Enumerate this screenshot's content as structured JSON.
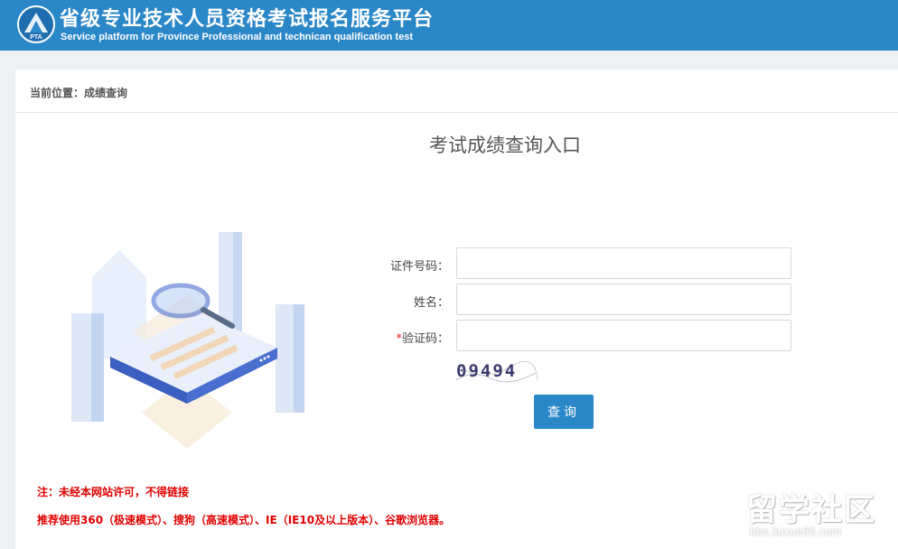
{
  "header": {
    "title_cn": "省级专业技术人员资格考试报名服务平台",
    "title_en": "Service platform for Province Professional and technican qualification test",
    "logo_text": "PTA"
  },
  "breadcrumb": "当前位置：成绩查询",
  "form": {
    "title": "考试成绩查询入口",
    "id_label": "证件号码：",
    "id_value": "",
    "name_label": "姓名：",
    "name_value": "",
    "captcha_required_mark": "*",
    "captcha_label": "验证码：",
    "captcha_value": "",
    "captcha_image_text": "09494",
    "submit_label": "查询"
  },
  "notes": {
    "line1": "注：未经本网站许可，不得链接",
    "line2": "推荐使用360（极速模式）、搜狗（高速模式）、IE（IE10及以上版本）、谷歌浏览器。"
  },
  "watermark": {
    "big": "留学社区",
    "small": "bbs.liuxue86.com"
  },
  "colors": {
    "brand": "#2a87c8",
    "warning": "#e00000"
  }
}
